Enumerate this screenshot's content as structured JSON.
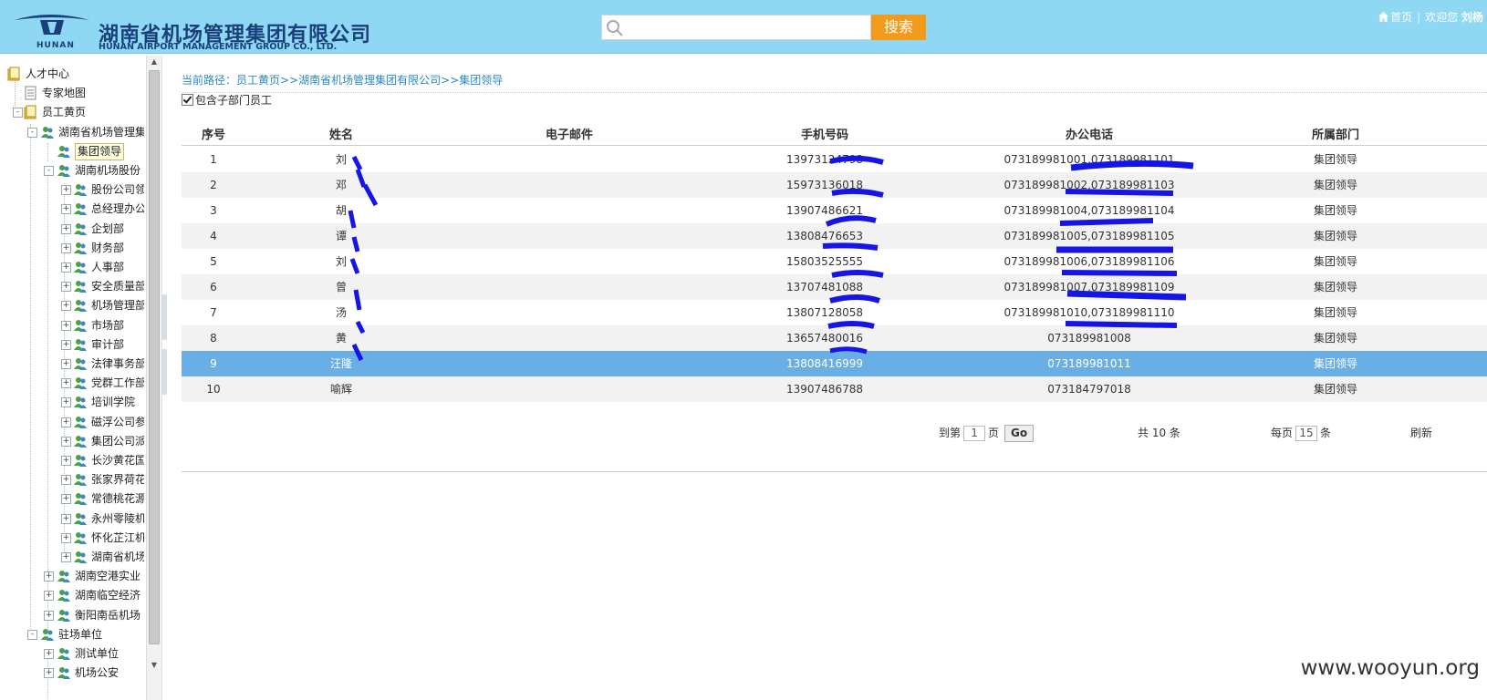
{
  "header": {
    "company_cn": "湖南省机场管理集团有限公司",
    "company_en": "HUNAN AIRPORT MANAGEMENT GROUP CO., LTD.",
    "logo_small": "HUNAN",
    "search_placeholder": "",
    "search_button": "搜索",
    "home_link": "首页",
    "welcome": "欢迎您",
    "user_name": "刘杨"
  },
  "sidebar": {
    "nodes": [
      {
        "label": "人才中心"
      },
      {
        "label": "专家地图"
      },
      {
        "label": "员工黄页"
      },
      {
        "label": "湖南省机场管理集"
      },
      {
        "label": "集团领导"
      },
      {
        "label": "湖南机场股份"
      },
      {
        "label": "股份公司领"
      },
      {
        "label": "总经理办公"
      },
      {
        "label": "企划部"
      },
      {
        "label": "财务部"
      },
      {
        "label": "人事部"
      },
      {
        "label": "安全质量部"
      },
      {
        "label": "机场管理部"
      },
      {
        "label": "市场部"
      },
      {
        "label": "审计部"
      },
      {
        "label": "法律事务部"
      },
      {
        "label": "党群工作部"
      },
      {
        "label": "培训学院"
      },
      {
        "label": "磁浮公司参"
      },
      {
        "label": "集团公司派"
      },
      {
        "label": "长沙黄花国"
      },
      {
        "label": "张家界荷花"
      },
      {
        "label": "常德桃花源"
      },
      {
        "label": "永州零陵机"
      },
      {
        "label": "怀化芷江机"
      },
      {
        "label": "湖南省机场"
      },
      {
        "label": "湖南空港实业"
      },
      {
        "label": "湖南临空经济"
      },
      {
        "label": "衡阳南岳机场"
      },
      {
        "label": "驻场单位"
      },
      {
        "label": "测试单位"
      },
      {
        "label": "机场公安"
      }
    ]
  },
  "main": {
    "breadcrumb": "当前路径：员工黄页>>湖南省机场管理集团有限公司>>集团领导",
    "include_sub": "包含子部门员工",
    "columns": [
      "序号",
      "姓名",
      "电子邮件",
      "手机号码",
      "办公电话",
      "所属部门"
    ],
    "rows": [
      [
        "1",
        "刘",
        "",
        "13973124798",
        "073189981001,073189981101",
        "集团领导"
      ],
      [
        "2",
        "邓",
        "",
        "15973136018",
        "073189981002,073189981103",
        "集团领导"
      ],
      [
        "3",
        "胡",
        "",
        "13907486621",
        "073189981004,073189981104",
        "集团领导"
      ],
      [
        "4",
        "谭",
        "",
        "13808476653",
        "073189981005,073189981105",
        "集团领导"
      ],
      [
        "5",
        "刘",
        "",
        "15803525555",
        "073189981006,073189981106",
        "集团领导"
      ],
      [
        "6",
        "曾",
        "",
        "13707481088",
        "073189981007,073189981109",
        "集团领导"
      ],
      [
        "7",
        "汤",
        "",
        "13807128058",
        "073189981010,073189981110",
        "集团领导"
      ],
      [
        "8",
        "黄",
        "",
        "13657480016",
        "073189981008",
        "集团领导"
      ],
      [
        "9",
        "汪隆",
        "",
        "13808416999",
        "073189981011",
        "集团领导"
      ],
      [
        "10",
        "喻辉",
        "",
        "13907486788",
        "073184797018",
        "集团领导"
      ]
    ],
    "selected_row": 9,
    "pager": {
      "goto_prefix": "到第",
      "page_value": "1",
      "page_suffix": "页",
      "go": "Go",
      "total": "共 10 条",
      "per_page_prefix": "每页",
      "per_page_value": "15",
      "per_page_suffix": "条",
      "refresh": "刷新"
    }
  },
  "watermark": "www.wooyun.org",
  "colors": {
    "header_bg": "#8ed8f4",
    "accent_orange": "#f49a1a",
    "link_blue": "#2a88c2",
    "selected_row": "#6aaee6",
    "redaction_blue": "#1515e6"
  }
}
